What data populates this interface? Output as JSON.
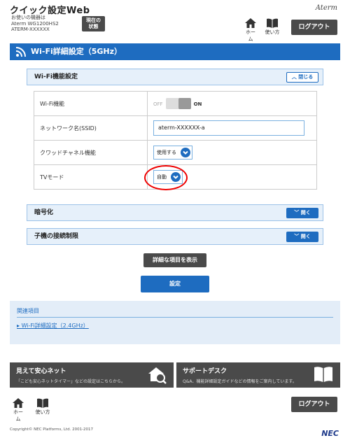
{
  "header": {
    "title": "クイック設定Web",
    "device_line1": "お使いの機器は",
    "device_line2": "Aterm WG1200HS2",
    "device_line3": "ATERM-XXXXXX",
    "status_btn_line1": "現在の",
    "status_btn_line2": "状態",
    "logo": "Aterm",
    "home_label": "ホーム",
    "howto_label": "使い方",
    "logout_label": "ログアウト"
  },
  "page": {
    "title": "Wi-Fi詳細設定（5GHz）"
  },
  "wifi_section": {
    "title": "Wi-Fi機能設定",
    "toggle_label": "閉じる",
    "rows": [
      {
        "label": "Wi-Fi機能"
      },
      {
        "label": "ネットワーク名(SSID)"
      },
      {
        "label": "クワッドチャネル機能"
      },
      {
        "label": "TVモード"
      }
    ],
    "switch_off": "OFF",
    "switch_on": "ON",
    "ssid_value": "aterm-XXXXXX-a",
    "quad_value": "使用する",
    "tv_value": "自動"
  },
  "encryption_section": {
    "title": "暗号化",
    "toggle_label": "開く"
  },
  "restriction_section": {
    "title": "子機の接続制限",
    "toggle_label": "開く"
  },
  "buttons": {
    "show_details": "詳細な項目を表示",
    "submit": "設定"
  },
  "related": {
    "heading": "関連項目",
    "link": "Wi-Fi詳細設定（2.4GHz）"
  },
  "promos": [
    {
      "title": "見えて安心ネット",
      "sub": "「こども安心ネットタイマー」などの設定はこちらから。",
      "icon": "house-search-icon"
    },
    {
      "title": "サポートデスク",
      "sub": "Q&A、機能詳細設定ガイドなどの情報をご案内しています。",
      "icon": "book-icon"
    }
  ],
  "footer": {
    "home_label": "ホーム",
    "howto_label": "使い方",
    "logout_label": "ログアウト",
    "copyright": "Copyright© NEC Platforms, Ltd. 2001-2017",
    "brand": "NEC"
  },
  "colors": {
    "accent": "#1e6cc0",
    "dark_button": "#4a4a4a",
    "highlight": "#e00000"
  }
}
